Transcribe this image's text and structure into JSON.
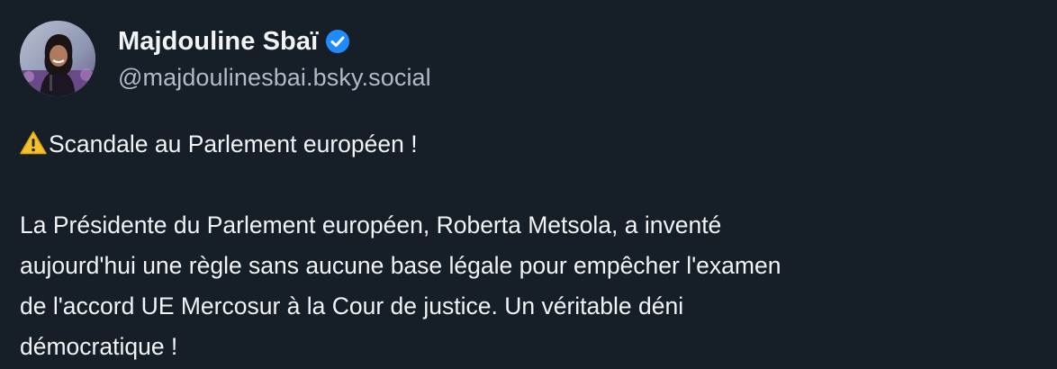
{
  "author": {
    "display_name": "Majdouline Sbaï",
    "handle": "@majdoulinesbai.bsky.social",
    "verified": true,
    "avatar": "profile-photo"
  },
  "post": {
    "warning_icon": "warning-icon",
    "headline": "Scandale au Parlement européen !",
    "body_lines": [
      "La Présidente du Parlement européen, Roberta Metsola, a inventé",
      "aujourd'hui une règle sans aucune base légale pour empêcher l'examen",
      "de l'accord UE Mercosur à la Cour de justice. Un véritable déni",
      "démocratique !"
    ]
  },
  "colors": {
    "background": "#161e27",
    "text": "#f1f3f5",
    "handle": "#aebbc9",
    "verified_badge": "#208bfe",
    "warning": "#f4c32c"
  }
}
